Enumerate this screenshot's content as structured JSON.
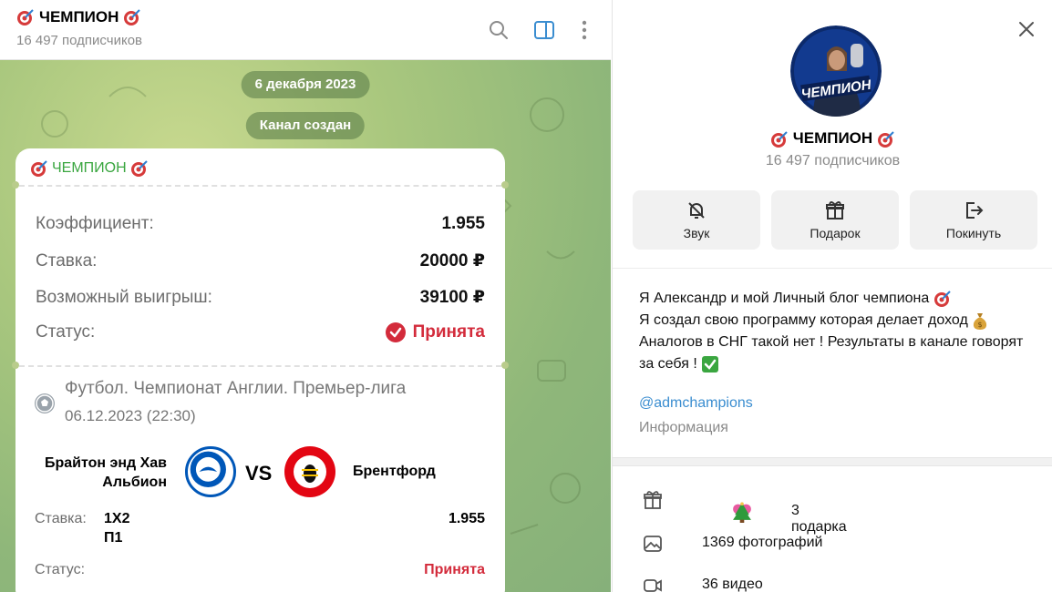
{
  "chat": {
    "title": "ЧЕМПИОН",
    "subscribers": "16 497 подписчиков",
    "date_pill": "6 декабря 2023",
    "service_pill": "Канал создан",
    "message": {
      "author": "ЧЕМПИОН",
      "coef_label": "Коэффициент:",
      "coef_value": "1.955",
      "stake_label": "Ставка:",
      "stake_value": "20000 ₽",
      "win_label": "Возможный выигрыш:",
      "win_value": "39100 ₽",
      "status_label": "Статус:",
      "status_value": "Принята",
      "league": "Футбол. Чемпионат Англии. Премьер-лига",
      "match_date": "06.12.2023 (22:30)",
      "team1": "Брайтон энд Хав Альбион",
      "vs": "VS",
      "team2": "Брентфорд",
      "bet_label": "Ставка:",
      "bet_type": "1X2",
      "bet_pick": "П1",
      "bet_coef": "1.955",
      "bet_status_label": "Статус:",
      "bet_status_value": "Принята"
    }
  },
  "panel": {
    "title": "ЧЕМПИОН",
    "subscribers": "16 497 подписчиков",
    "avatar_text": "ЧЕМПИОН",
    "actions": [
      {
        "label": "Звук",
        "icon": "bell-off-icon"
      },
      {
        "label": "Подарок",
        "icon": "gift-icon"
      },
      {
        "label": "Покинуть",
        "icon": "leave-icon"
      }
    ],
    "about": [
      "Я Александр и мой Личный блог чемпиона",
      "Я создал свою программу которая делает доход",
      "Аналогов в СНГ такой нет ! Результаты  в канале говорят за себя !"
    ],
    "link": "@admchampions",
    "info_label": "Информация",
    "media": [
      {
        "label": "3 подарка",
        "icon": "gift-icon"
      },
      {
        "label": "1369 фотографий",
        "icon": "photo-icon"
      },
      {
        "label": "36 видео",
        "icon": "video-icon"
      }
    ]
  },
  "colors": {
    "accent_green": "#3aa640",
    "status_red": "#d32b3b",
    "link_blue": "#3a8dd0",
    "header_blue": "#3a8dd0"
  }
}
